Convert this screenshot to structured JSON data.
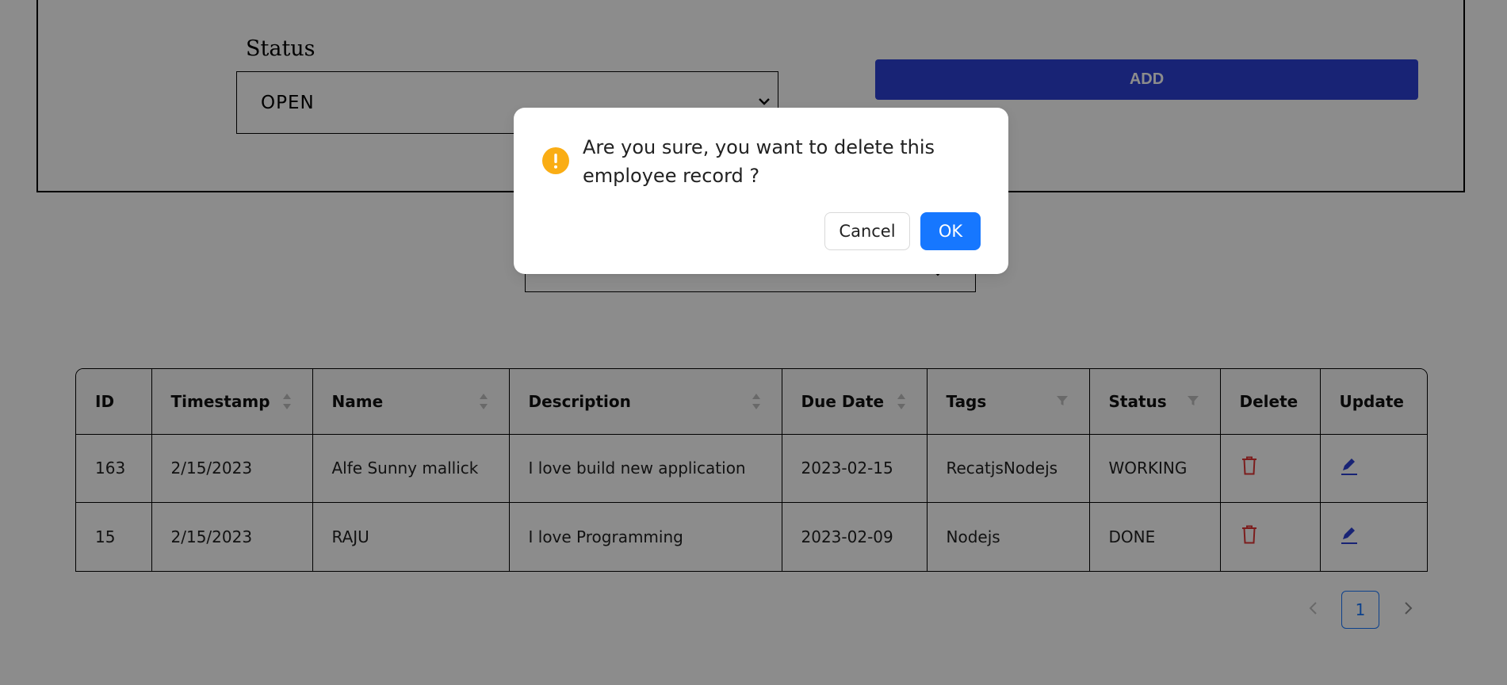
{
  "form": {
    "status_label": "Status",
    "status_value": "OPEN",
    "add_label": "ADD"
  },
  "table": {
    "columns": [
      "ID",
      "Timestamp",
      "Name",
      "Description",
      "Due Date",
      "Tags",
      "Status",
      "Delete",
      "Update"
    ],
    "rows": [
      {
        "id": "163",
        "timestamp": "2/15/2023",
        "name": "Alfe Sunny mallick",
        "description": "I love build new application",
        "due_date": "2023-02-15",
        "tags": "RecatjsNodejs",
        "status": "WORKING"
      },
      {
        "id": "15",
        "timestamp": "2/15/2023",
        "name": "RAJU",
        "description": "I love Programming",
        "due_date": "2023-02-09",
        "tags": "Nodejs",
        "status": "DONE"
      }
    ]
  },
  "pagination": {
    "current_page": "1"
  },
  "modal": {
    "message": "Are you sure, you want to delete this employee record ?",
    "cancel_label": "Cancel",
    "ok_label": "OK"
  },
  "colors": {
    "accent": "#1677ff",
    "add_button": "#2d41d6",
    "warning": "#faad14",
    "delete_icon": "#e23636",
    "edit_icon": "#2d41d6"
  },
  "icons": {
    "modal": "exclamation-circle-icon",
    "delete": "trash-icon",
    "update": "edit-pencil-icon",
    "sort": "sort-caret-icon",
    "filter": "filter-funnel-icon"
  }
}
